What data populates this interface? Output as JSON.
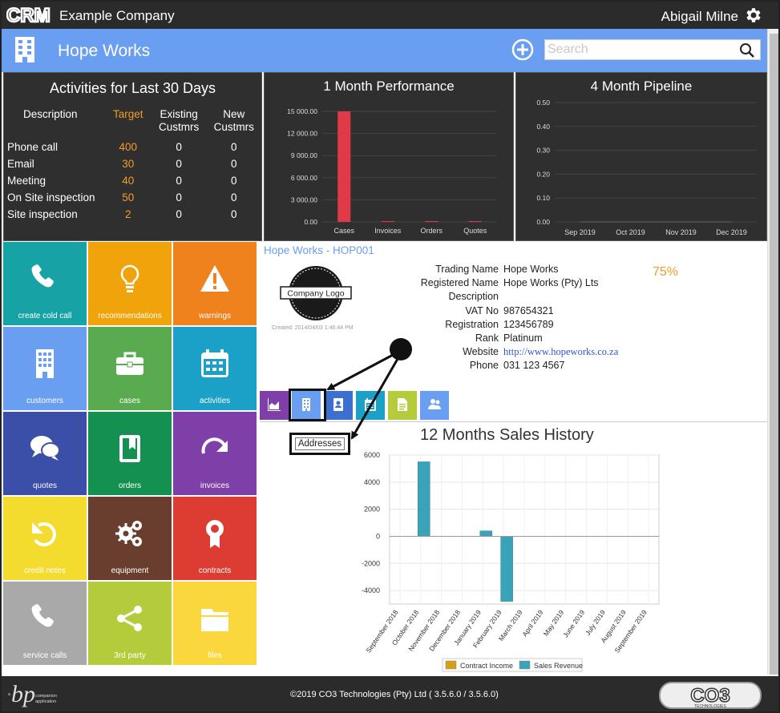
{
  "app": {
    "logo_text": "CRM",
    "company_name": "Example Company",
    "user_name": "Abigail Milne"
  },
  "header": {
    "title": "Hope Works",
    "search_placeholder": "Search"
  },
  "activities": {
    "title": "Activities for Last 30 Days",
    "columns": [
      "Description",
      "Target",
      "Existing Custmrs",
      "New Custmrs"
    ],
    "rows": [
      {
        "description": "Phone call",
        "target": "400",
        "existing": "0",
        "new": "0"
      },
      {
        "description": "Email",
        "target": "30",
        "existing": "0",
        "new": "0"
      },
      {
        "description": "Meeting",
        "target": "40",
        "existing": "0",
        "new": "0"
      },
      {
        "description": "On Site inspection",
        "target": "50",
        "existing": "0",
        "new": "0"
      },
      {
        "description": "Site inspection",
        "target": "2",
        "existing": "0",
        "new": "0"
      }
    ]
  },
  "performance": {
    "title": "1 Month Performance"
  },
  "pipeline": {
    "title": "4 Month Pipeline"
  },
  "tiles": [
    {
      "label": "create cold call",
      "icon": "phone-icon",
      "color": "#17a2a6"
    },
    {
      "label": "recommendations",
      "icon": "lightbulb-icon",
      "color": "#f0a30a"
    },
    {
      "label": "warnings",
      "icon": "warning-icon",
      "color": "#f0821e"
    },
    {
      "label": "customers",
      "icon": "building-icon",
      "color": "#6a9ef0"
    },
    {
      "label": "cases",
      "icon": "briefcase-icon",
      "color": "#5aaa50"
    },
    {
      "label": "activities",
      "icon": "calendar-icon",
      "color": "#1ba0c8"
    },
    {
      "label": "quotes",
      "icon": "chat-icon",
      "color": "#3b4fa8"
    },
    {
      "label": "orders",
      "icon": "book-icon",
      "color": "#149150"
    },
    {
      "label": "invoices",
      "icon": "redo-arrow-icon",
      "color": "#7f3fa8"
    },
    {
      "label": "credit notes",
      "icon": "undo-arrow-icon",
      "color": "#f3dc2e"
    },
    {
      "label": "equipment",
      "icon": "gears-icon",
      "color": "#6a3e2e"
    },
    {
      "label": "contracts",
      "icon": "award-icon",
      "color": "#dc3c32"
    },
    {
      "label": "service calls",
      "icon": "phone-icon",
      "color": "#a9a9a9"
    },
    {
      "label": "3rd party",
      "icon": "share-icon",
      "color": "#b4cc3c"
    },
    {
      "label": "files",
      "icon": "folder-icon",
      "color": "#fad73c"
    }
  ],
  "record": {
    "title": "Hope Works - HOP001",
    "logo_text": "Company Logo",
    "created": "Created: 2014/04/03 1:46:44 PM",
    "completion": "75%",
    "fields": [
      {
        "label": "Trading Name",
        "value": "Hope Works"
      },
      {
        "label": "Registered Name",
        "value": "Hope Works (Pty) Lts"
      },
      {
        "label": "Description",
        "value": ""
      },
      {
        "label": "VAT No",
        "value": "987654321"
      },
      {
        "label": "Registration",
        "value": "123456789"
      },
      {
        "label": "Rank",
        "value": "Platinum"
      },
      {
        "label": "Website",
        "value": "http://www.hopeworks.co.za"
      },
      {
        "label": "Phone",
        "value": "031 123 4567"
      }
    ],
    "tabs": [
      {
        "icon": "area-chart-icon",
        "color": "#7f3fa8"
      },
      {
        "icon": "building-icon",
        "color": "#6a9ef0"
      },
      {
        "icon": "contacts-book-icon",
        "color": "#3b6fd0"
      },
      {
        "icon": "calendar-icon",
        "color": "#1ba0c8"
      },
      {
        "icon": "document-icon",
        "color": "#b4cc3c"
      },
      {
        "icon": "users-icon",
        "color": "#6a9ef0"
      }
    ],
    "tooltip": "Addresses"
  },
  "sales_history": {
    "title": "12 Months Sales History"
  },
  "footer": {
    "logo_text": "a companion application",
    "copyright": "©2019 CO3 Technologies (Pty) Ltd ( 3.5.6.0 / 3.5.6.0)",
    "co3_text": "CO3",
    "co3_sub": "TECHNOLOGIES"
  },
  "chart_data": [
    {
      "type": "bar",
      "title": "1 Month Performance",
      "categories": [
        "Cases",
        "Invoices",
        "Orders",
        "Quotes"
      ],
      "values": [
        15000,
        0,
        0,
        0
      ],
      "ylim": [
        0,
        15000
      ],
      "yticks": [
        "0.00",
        "3 000.00",
        "6 000.00",
        "9 000.00",
        "12 000.00",
        "15 000.00"
      ],
      "color": "#e03a4a"
    },
    {
      "type": "line",
      "title": "4 Month Pipeline",
      "categories": [
        "Sep 2019",
        "Oct 2019",
        "Nov 2019",
        "Dec 2019"
      ],
      "values": [
        0,
        0,
        0,
        0
      ],
      "ylim": [
        0,
        0.5
      ],
      "yticks": [
        "0.00",
        "0.10",
        "0.20",
        "0.30",
        "0.40",
        "0.50"
      ]
    },
    {
      "type": "bar",
      "title": "12 Months Sales History",
      "categories": [
        "September 2018",
        "October 2018",
        "November 2018",
        "December 2018",
        "January 2019",
        "February 2019",
        "March 2019",
        "April 2019",
        "May 2019",
        "June 2019",
        "July 2019",
        "August 2019",
        "September 2019"
      ],
      "series": [
        {
          "name": "Contract Income",
          "color": "#d4a017",
          "values": [
            0,
            0,
            0,
            0,
            0,
            0,
            0,
            0,
            0,
            0,
            0,
            0,
            0
          ]
        },
        {
          "name": "Sales Revenue",
          "color": "#3ba3b8",
          "values": [
            0,
            5500,
            0,
            0,
            400,
            -4800,
            0,
            0,
            0,
            0,
            0,
            0,
            0
          ]
        }
      ],
      "ylim": [
        -5000,
        6000
      ],
      "yticks": [
        "-4000",
        "-2000",
        "0",
        "2000",
        "4000",
        "6000"
      ],
      "legend": "bottom"
    }
  ]
}
